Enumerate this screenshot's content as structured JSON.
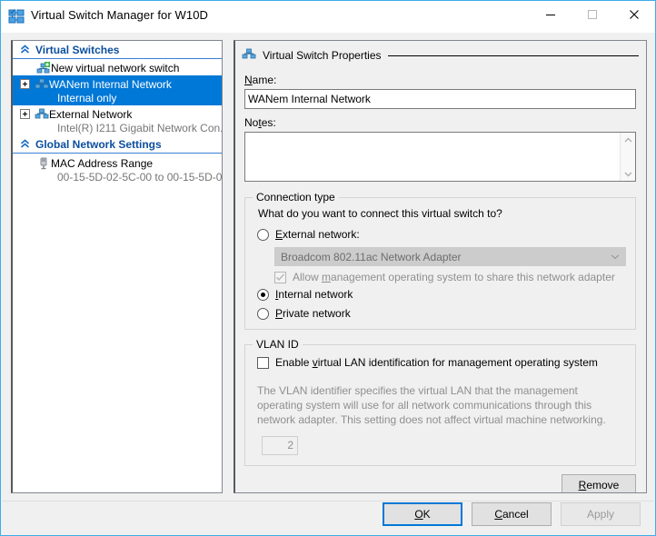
{
  "window": {
    "title": "Virtual Switch Manager for W10D",
    "app_icon": "hyperv-switch-icon",
    "accent_color": "#0078d7",
    "border_color": "#3daee9",
    "controls": {
      "minimize": "minimize-icon",
      "maximize": "maximize-icon",
      "close": "close-icon"
    }
  },
  "tree": {
    "sections": [
      {
        "header": "Virtual Switches",
        "items": [
          {
            "label": "New virtual network switch",
            "sub": "",
            "icon": "new-switch-icon",
            "expander": false,
            "selected": false
          },
          {
            "label": "WANem Internal Network",
            "sub": "Internal only",
            "icon": "switch-icon",
            "expander": true,
            "selected": true
          },
          {
            "label": "External Network",
            "sub": "Intel(R) I211 Gigabit Network Con...",
            "icon": "switch-icon",
            "expander": true,
            "selected": false
          }
        ]
      },
      {
        "header": "Global Network Settings",
        "items": [
          {
            "label": "MAC Address Range",
            "sub": "00-15-5D-02-5C-00 to 00-15-5D-0...",
            "icon": "mac-range-icon",
            "expander": false,
            "selected": false
          }
        ]
      }
    ]
  },
  "properties": {
    "header_title": "Virtual Switch Properties",
    "header_icon": "switch-icon",
    "name_label_prefix": "",
    "name_label": "Name:",
    "name_value": "WANem Internal Network",
    "notes_label": "Notes:",
    "notes_value": ""
  },
  "connection_type": {
    "group_title": "Connection type",
    "question": "What do you want to connect this virtual switch to?",
    "options": [
      {
        "id": "external",
        "label": "External network:",
        "selected": false
      },
      {
        "id": "internal",
        "label": "Internal network",
        "selected": true
      },
      {
        "id": "private",
        "label": "Private network",
        "selected": false
      }
    ],
    "adapter_value": "Broadcom 802.11ac Network Adapter",
    "allow_management_label": "Allow management operating system to share this network adapter",
    "allow_management_checked": true,
    "allow_management_enabled": false
  },
  "vlan": {
    "group_title": "VLAN ID",
    "enable_label": "Enable virtual LAN identification for management operating system",
    "enable_checked": false,
    "description": "The VLAN identifier specifies the virtual LAN that the management operating system will use for all network communications through this network adapter. This setting does not affect virtual machine networking.",
    "id_value": "2",
    "id_enabled": false
  },
  "buttons": {
    "remove": "Remove",
    "ok": "OK",
    "cancel": "Cancel",
    "apply": "Apply",
    "apply_enabled": false,
    "ok_is_default": true
  }
}
